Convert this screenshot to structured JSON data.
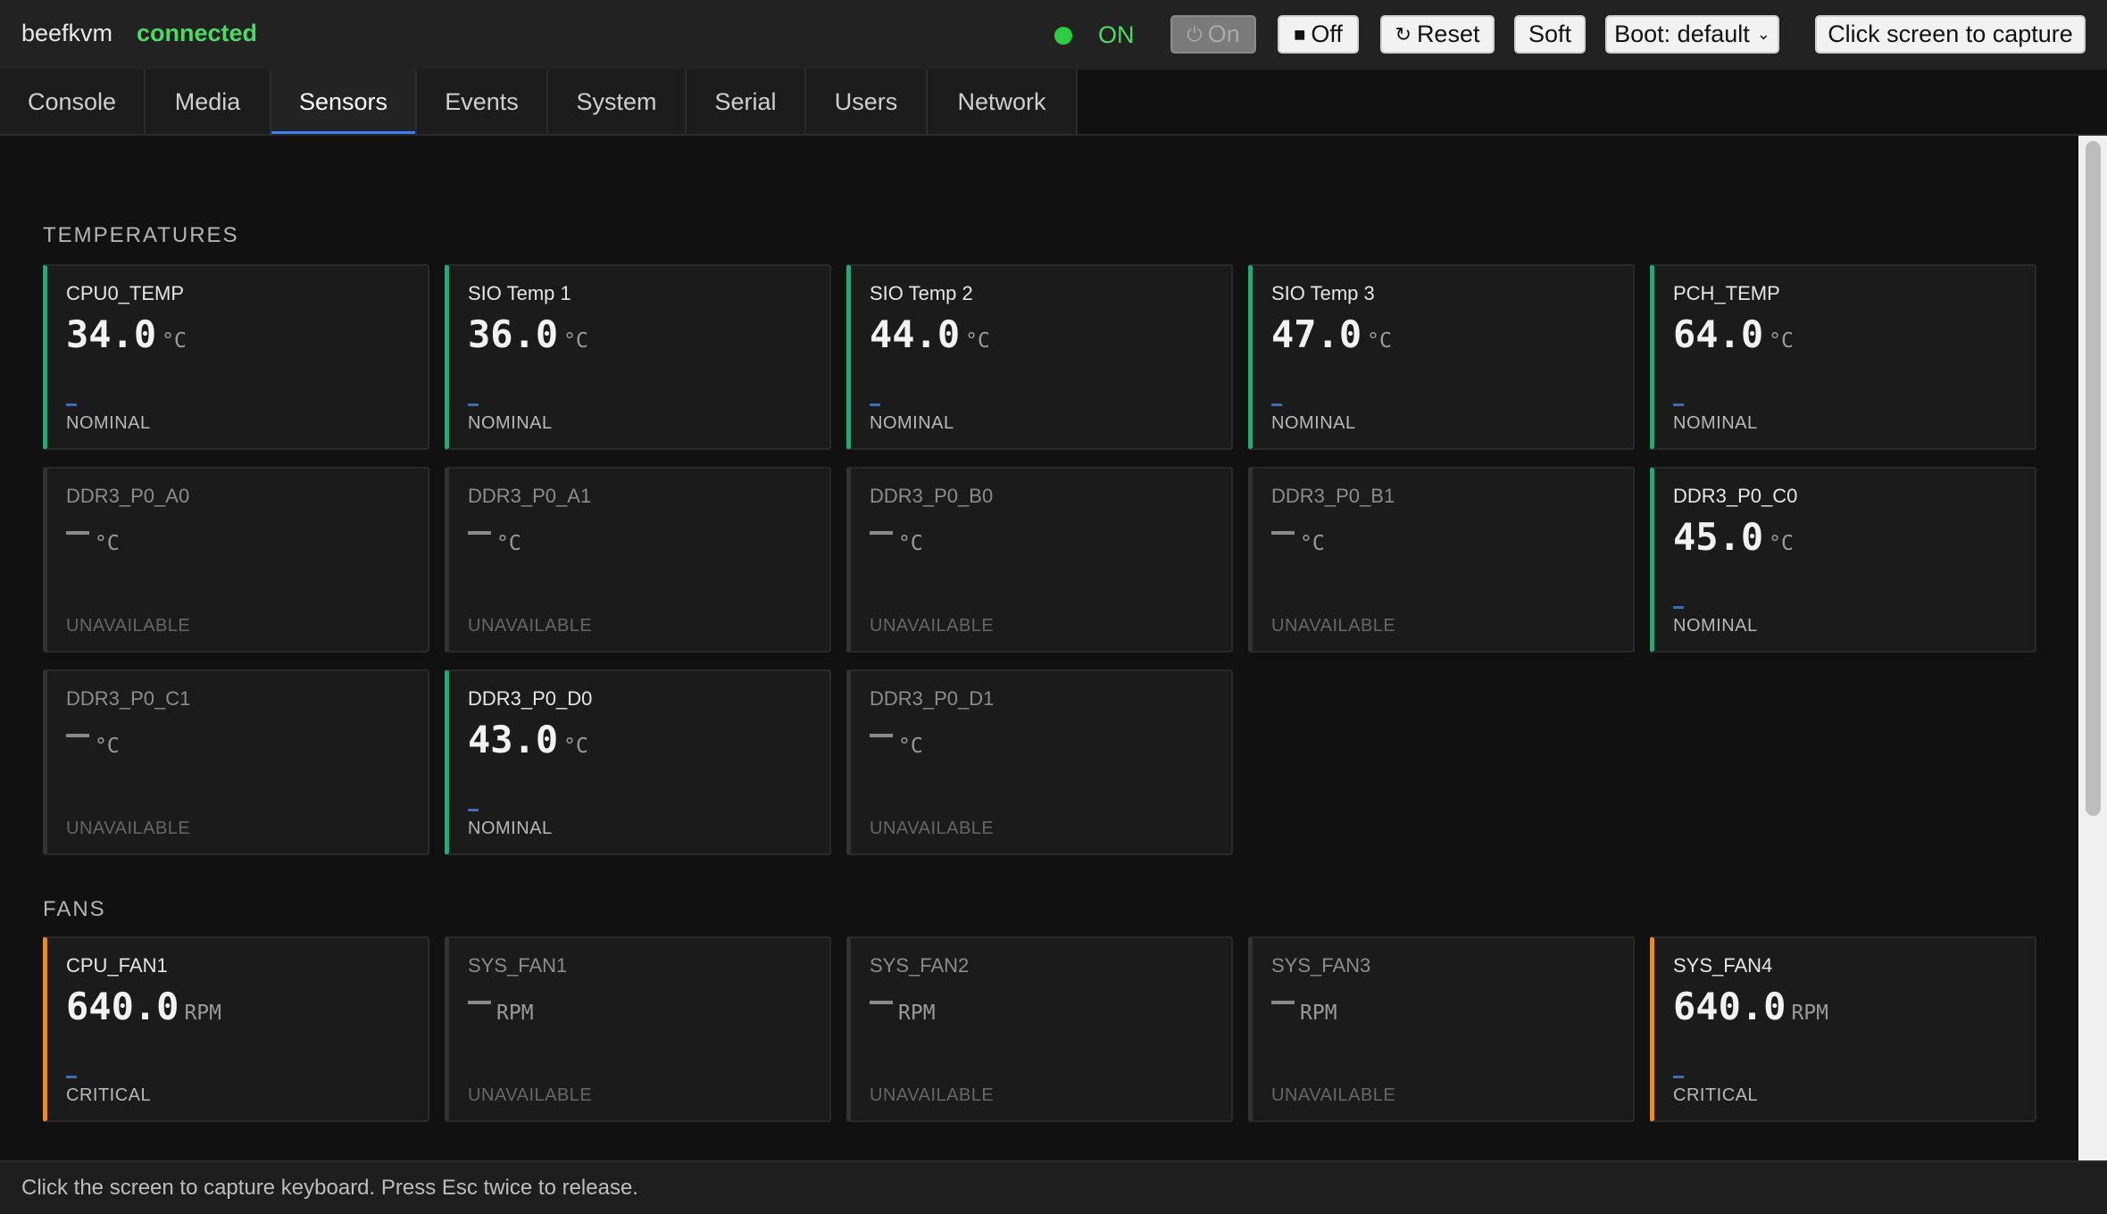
{
  "topbar": {
    "brand": "beefkvm",
    "connection": "connected",
    "power_state": "ON",
    "buttons": {
      "on": "On",
      "off": "Off",
      "reset": "Reset",
      "soft": "Soft",
      "boot": "Boot: default",
      "capture": "Click screen to capture"
    },
    "colors": {
      "connected": "#4cd964",
      "power_dot": "#2ecc40"
    }
  },
  "tabs": [
    {
      "label": "Console"
    },
    {
      "label": "Media"
    },
    {
      "label": "Sensors",
      "active": true
    },
    {
      "label": "Events"
    },
    {
      "label": "System"
    },
    {
      "label": "Serial"
    },
    {
      "label": "Users"
    },
    {
      "label": "Network"
    }
  ],
  "sections": {
    "temperatures": {
      "title": "TEMPERATURES",
      "sensors": [
        {
          "name": "CPU0_TEMP",
          "value": "34.0",
          "unit": "°C",
          "status": "NOMINAL"
        },
        {
          "name": "SIO Temp 1",
          "value": "36.0",
          "unit": "°C",
          "status": "NOMINAL"
        },
        {
          "name": "SIO Temp 2",
          "value": "44.0",
          "unit": "°C",
          "status": "NOMINAL"
        },
        {
          "name": "SIO Temp 3",
          "value": "47.0",
          "unit": "°C",
          "status": "NOMINAL"
        },
        {
          "name": "PCH_TEMP",
          "value": "64.0",
          "unit": "°C",
          "status": "NOMINAL"
        },
        {
          "name": "DDR3_P0_A0",
          "value": "",
          "unit": "°C",
          "status": "UNAVAILABLE"
        },
        {
          "name": "DDR3_P0_A1",
          "value": "",
          "unit": "°C",
          "status": "UNAVAILABLE"
        },
        {
          "name": "DDR3_P0_B0",
          "value": "",
          "unit": "°C",
          "status": "UNAVAILABLE"
        },
        {
          "name": "DDR3_P0_B1",
          "value": "",
          "unit": "°C",
          "status": "UNAVAILABLE"
        },
        {
          "name": "DDR3_P0_C0",
          "value": "45.0",
          "unit": "°C",
          "status": "NOMINAL"
        },
        {
          "name": "DDR3_P0_C1",
          "value": "",
          "unit": "°C",
          "status": "UNAVAILABLE"
        },
        {
          "name": "DDR3_P0_D0",
          "value": "43.0",
          "unit": "°C",
          "status": "NOMINAL"
        },
        {
          "name": "DDR3_P0_D1",
          "value": "",
          "unit": "°C",
          "status": "UNAVAILABLE"
        }
      ]
    },
    "fans": {
      "title": "FANS",
      "sensors": [
        {
          "name": "CPU_FAN1",
          "value": "640.0",
          "unit": "RPM",
          "status": "CRITICAL"
        },
        {
          "name": "SYS_FAN1",
          "value": "",
          "unit": "RPM",
          "status": "UNAVAILABLE"
        },
        {
          "name": "SYS_FAN2",
          "value": "",
          "unit": "RPM",
          "status": "UNAVAILABLE"
        },
        {
          "name": "SYS_FAN3",
          "value": "",
          "unit": "RPM",
          "status": "UNAVAILABLE"
        },
        {
          "name": "SYS_FAN4",
          "value": "640.0",
          "unit": "RPM",
          "status": "CRITICAL"
        }
      ]
    }
  },
  "status_colors": {
    "NOMINAL": "#2fa37a",
    "CRITICAL": "#e88a2e",
    "UNAVAILABLE": "#333333"
  },
  "footer": {
    "hint": "Click the screen to capture keyboard. Press Esc twice to release."
  }
}
